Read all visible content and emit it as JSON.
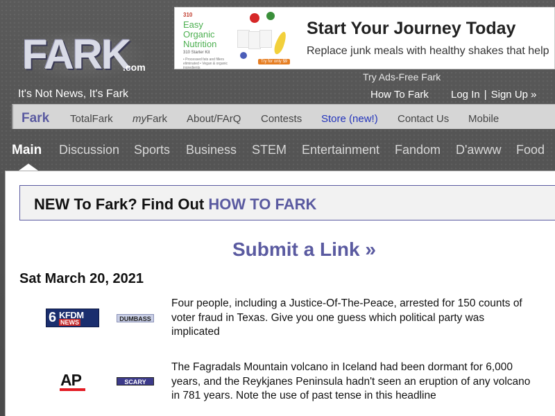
{
  "site": {
    "logo_text": "FARK",
    "logo_tld": ".com",
    "tagline": "It's Not News, It's Fark"
  },
  "ad": {
    "brand": "310",
    "kit_title": "Easy Organic Nutrition",
    "kit_subtitle": "310 Starter Kit",
    "kit_bullets": "• Processed fats and fillers eliminated • Vegan & organic ingredients",
    "kit_cta": "Try for only $9",
    "headline": "Start Your Journey Today",
    "body": "Replace junk meals with healthy shakes that help"
  },
  "header_links": {
    "ads_free": "Try Ads-Free Fark",
    "how_to": "How To Fark",
    "login": "Log In",
    "separator": "|",
    "signup": "Sign Up »"
  },
  "topnav": {
    "fark": "Fark",
    "totalfark": "TotalFark",
    "myfark_prefix": "my",
    "myfark_suffix": "Fark",
    "about": "About/FArQ",
    "contests": "Contests",
    "store": "Store (new!)",
    "contact": "Contact Us",
    "mobile": "Mobile"
  },
  "tabs": {
    "main": "Main",
    "discussion": "Discussion",
    "sports": "Sports",
    "business": "Business",
    "stem": "STEM",
    "entertainment": "Entertainment",
    "fandom": "Fandom",
    "dawww": "D'awww",
    "food": "Food"
  },
  "banner": {
    "text": "NEW To Fark? Find Out ",
    "link": "HOW TO FARK"
  },
  "submit_link": "Submit a Link »",
  "date": "Sat March 20, 2021",
  "stories": [
    {
      "source": "KFDM News",
      "source_num": "6",
      "source_call": "KFDM",
      "source_news": "NEWS",
      "tag": "DUMBASS",
      "tag_color": "#c9cfe6",
      "headline": "Four people, including a Justice-Of-The-Peace, arrested for 150 counts of voter fraud in Texas. Give you one guess which political party was implicated"
    },
    {
      "source": "AP",
      "source_accent": "#e31b23",
      "tag": "SCARY",
      "tag_color": "#3c3a8a",
      "headline": "The Fagradals Mountain volcano in Iceland had been dormant for 6,000 years, and the Reykjanes Peninsula hadn't seen an eruption of any volcano in 781 years. Note the use of past tense in this headline"
    }
  ],
  "colors": {
    "brand_purple": "#5a5aa0",
    "store_link": "#2233bb",
    "background": "#555555"
  }
}
